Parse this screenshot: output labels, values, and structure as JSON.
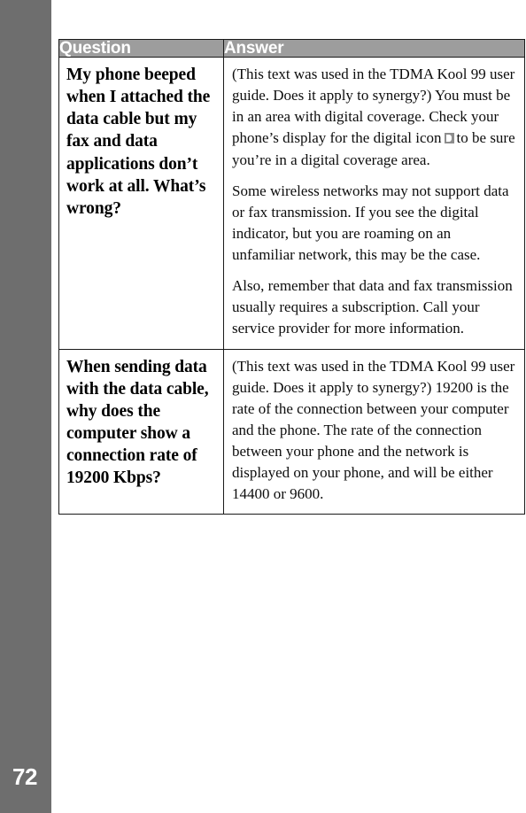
{
  "page": {
    "number": "72"
  },
  "table": {
    "headers": {
      "question": "Question",
      "answer": "Answer"
    },
    "rows": [
      {
        "question": "My phone beeped when I attached the data cable but my fax and data applications don’t work at all. What’s wrong?",
        "answer_paragraphs": [
          {
            "before_icon": "(This text was used in the TDMA Kool 99 user guide. Does it apply to synergy?) You must be in an area with digital coverage. Check your phone’s display for the digital icon",
            "icon": "digital-coverage-icon",
            "after_icon": "to be sure you’re in a digital coverage area."
          },
          {
            "text": "Some wireless networks may not support data or fax transmission. If you see the digital indicator, but you are roaming on an unfamiliar network, this may be the case."
          },
          {
            "text": "Also, remember that data and fax transmission usually requires a subscription. Call your service provider for more information."
          }
        ]
      },
      {
        "question": "When sending data with the data cable, why does the computer show a connection rate of 19200 Kbps?",
        "answer_paragraphs": [
          {
            "text": "(This text was used in the TDMA Kool 99 user guide. Does it apply to synergy?) 19200 is the rate of the connection between your computer and the phone. The rate of the connection between your phone and the network is displayed on your phone, and will be either 14400 or 9600."
          }
        ]
      }
    ]
  },
  "colors": {
    "page_edge_bar": "#6e6e6e",
    "header_background": "#9d9d9d",
    "header_text": "#ffffff",
    "table_border": "#1a1a1a",
    "body_text": "#0d0d0d"
  }
}
